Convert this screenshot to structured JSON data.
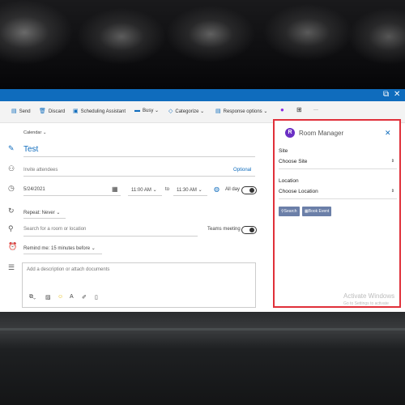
{
  "toolbar": {
    "send": "Send",
    "discard": "Discard",
    "scheduling": "Scheduling Assistant",
    "busy": "Busy",
    "categorize": "Categorize",
    "response": "Response options",
    "more": "···"
  },
  "form": {
    "calendar": "Calendar",
    "title": "Test",
    "invite_placeholder": "Invite attendees",
    "optional": "Optional",
    "date": "5/24/2021",
    "start_time": "11:00 AM",
    "to": "to",
    "end_time": "11:30 AM",
    "all_day": "All day",
    "repeat": "Repeat: Never",
    "location_placeholder": "Search for a room or location",
    "teams": "Teams meeting",
    "remind": "Remind me: 15 minutes before",
    "description_placeholder": "Add a description or attach documents"
  },
  "panel": {
    "title": "Room Manager",
    "site_label": "Site",
    "site_value": "Choose Site",
    "location_label": "Location",
    "location_value": "Choose Location",
    "search_btn": "Search",
    "book_btn": "Book Event",
    "watermark_title": "Activate Windows",
    "watermark_sub": "Go to Settings to activate"
  },
  "colors": {
    "accent": "#0f6cbd",
    "highlight": "#e0303a",
    "button": "#6b7fa8"
  }
}
